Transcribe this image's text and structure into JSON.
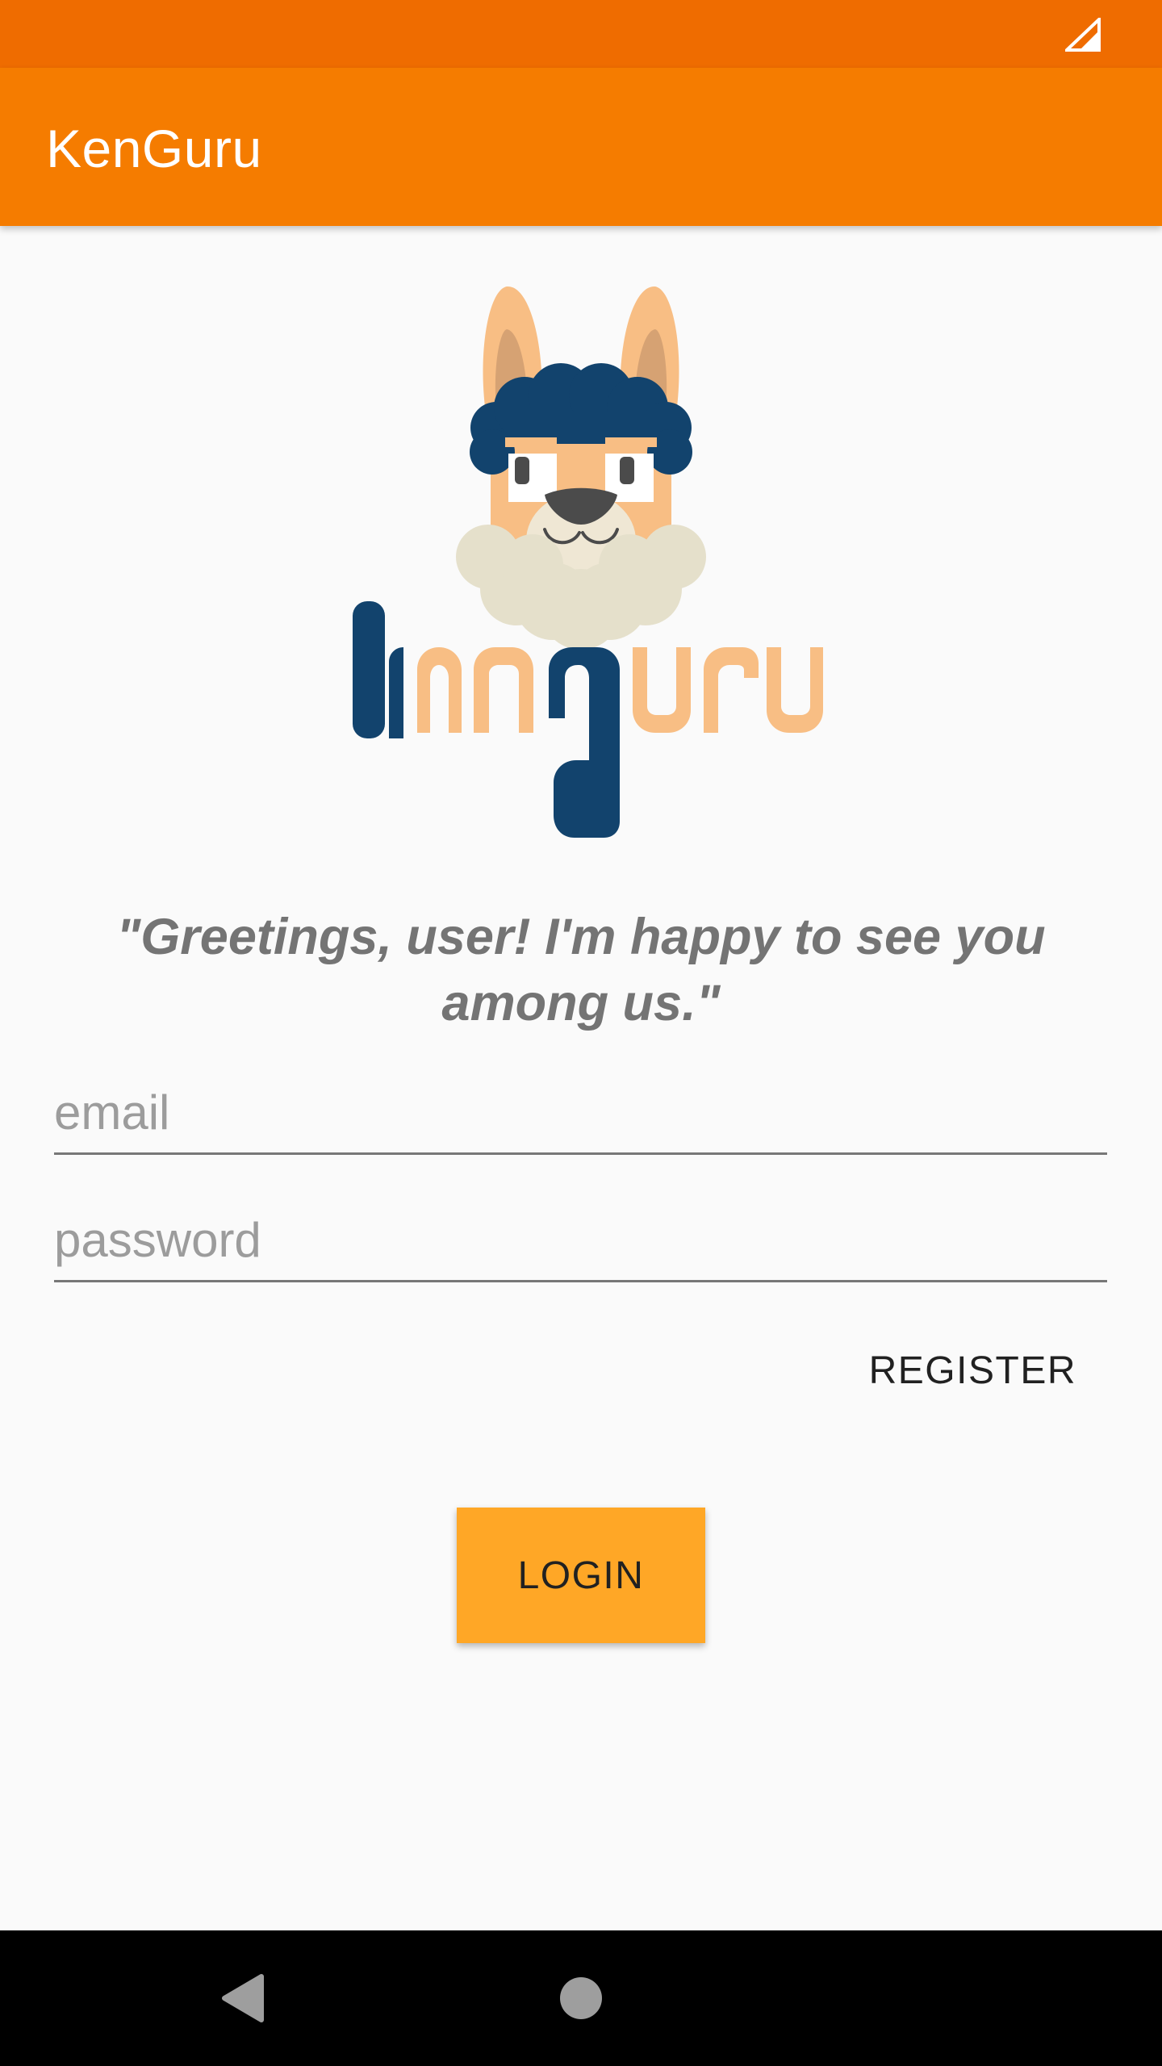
{
  "app_bar": {
    "title": "KenGuru"
  },
  "logo": {
    "wordmark": "kenguru"
  },
  "greeting": {
    "text": "\"Greetings, user! I'm happy to see you among us.\""
  },
  "form": {
    "email_placeholder": "email",
    "password_placeholder": "password",
    "register_label": "REGISTER",
    "login_label": "LOGIN"
  },
  "icons": {
    "status_signal": "signal-icon",
    "nav_back": "back-icon",
    "nav_home": "home-icon"
  },
  "colors": {
    "status_bar": "#ef6c00",
    "app_bar": "#f57c00",
    "login_button": "#ffa726",
    "logo_navy": "#12436d",
    "logo_peach": "#f8be84",
    "greeting_text": "#747474"
  }
}
